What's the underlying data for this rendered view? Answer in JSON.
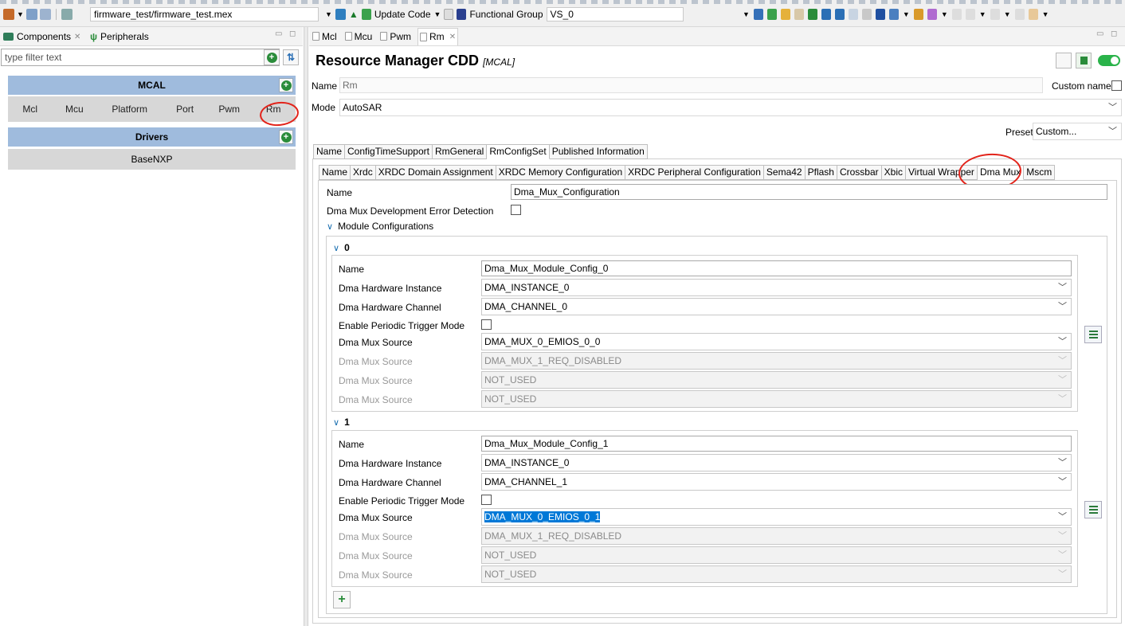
{
  "toolbar": {
    "path": "firmware_test/firmware_test.mex",
    "update_code": "Update Code",
    "functional_group_label": "Functional Group",
    "functional_group_value": "VS_0"
  },
  "left_panel": {
    "tabs": [
      "Components",
      "Peripherals"
    ],
    "filter_placeholder": "type filter text",
    "categories": [
      {
        "name": "MCAL",
        "components": [
          "Mcl",
          "Mcu",
          "Platform",
          "Port",
          "Pwm",
          "Rm"
        ]
      },
      {
        "name": "Drivers",
        "components": [
          "BaseNXP"
        ]
      }
    ]
  },
  "editor": {
    "tabs": [
      "Mcl",
      "Mcu",
      "Pwm",
      "Rm"
    ],
    "title": "Resource Manager CDD",
    "title_tag": "[MCAL]",
    "name_label": "Name",
    "name_value": "Rm",
    "custom_name_label": "Custom name",
    "mode_label": "Mode",
    "mode_value": "AutoSAR",
    "preset_label": "Preset",
    "preset_value": "Custom...",
    "outer_tabs": [
      "Name",
      "ConfigTimeSupport",
      "RmGeneral",
      "RmConfigSet",
      "Published Information"
    ],
    "inner_tabs": [
      "Name",
      "Xrdc",
      "XRDC Domain Assignment",
      "XRDC Memory Configuration",
      "XRDC Peripheral Configuration",
      "Sema42",
      "Pflash",
      "Crossbar",
      "Xbic",
      "Virtual Wrapper",
      "Dma Mux",
      "Mscm"
    ],
    "dma": {
      "name_label": "Name",
      "name_value": "Dma_Mux_Configuration",
      "det_label": "Dma Mux Development Error Detection",
      "module_configs_label": "Module Configurations",
      "fields": {
        "name": "Name",
        "instance": "Dma Hardware Instance",
        "channel": "Dma Hardware Channel",
        "periodic": "Enable Periodic Trigger Mode",
        "source": "Dma Mux Source"
      },
      "modules": [
        {
          "index": "0",
          "name": "Dma_Mux_Module_Config_0",
          "instance": "DMA_INSTANCE_0",
          "channel": "DMA_CHANNEL_0",
          "sources": [
            "DMA_MUX_0_EMIOS_0_0",
            "DMA_MUX_1_REQ_DISABLED",
            "NOT_USED",
            "NOT_USED"
          ]
        },
        {
          "index": "1",
          "name": "Dma_Mux_Module_Config_1",
          "instance": "DMA_INSTANCE_0",
          "channel": "DMA_CHANNEL_1",
          "sources": [
            "DMA_MUX_0_EMIOS_0_1",
            "DMA_MUX_1_REQ_DISABLED",
            "NOT_USED",
            "NOT_USED"
          ]
        }
      ],
      "add_symbol": "+"
    }
  }
}
